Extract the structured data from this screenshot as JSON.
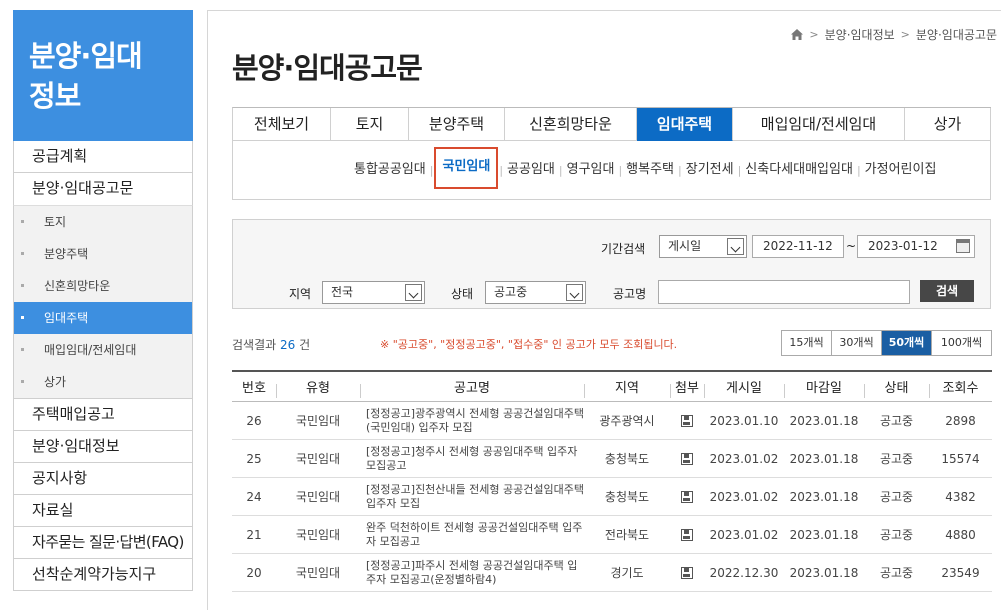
{
  "sidebar": {
    "title": "분양·임대\n정보",
    "items_top": [
      "공급계획",
      "분양·임대공고문"
    ],
    "sub_items": [
      {
        "label": "토지",
        "active": false
      },
      {
        "label": "분양주택",
        "active": false
      },
      {
        "label": "신혼희망타운",
        "active": false
      },
      {
        "label": "임대주택",
        "active": true
      },
      {
        "label": "매입임대/전세임대",
        "active": false
      },
      {
        "label": "상가",
        "active": false
      }
    ],
    "items_bottom": [
      "주택매입공고",
      "분양·임대정보",
      "공지사항",
      "자료실",
      "자주묻는 질문·답변(FAQ)",
      "선착순계약가능지구"
    ]
  },
  "breadcrumb": [
    "분양·임대정보",
    "분양·임대공고문"
  ],
  "page_title": "분양·임대공고문",
  "tabs": [
    {
      "label": "전체보기",
      "width": 98,
      "active": false
    },
    {
      "label": "토지",
      "width": 78,
      "active": false
    },
    {
      "label": "분양주택",
      "width": 96,
      "active": false
    },
    {
      "label": "신혼희망타운",
      "width": 132,
      "active": false
    },
    {
      "label": "임대주택",
      "width": 96,
      "active": true
    },
    {
      "label": "매입임대/전세임대",
      "width": 172,
      "active": false
    },
    {
      "label": "상가",
      "width": 86,
      "active": false
    }
  ],
  "subtabs": [
    {
      "label": "통합공공임대",
      "active": false
    },
    {
      "label": "국민임대",
      "active": true
    },
    {
      "label": "공공임대",
      "active": false
    },
    {
      "label": "영구임대",
      "active": false
    },
    {
      "label": "행복주택",
      "active": false
    },
    {
      "label": "장기전세",
      "active": false
    },
    {
      "label": "신축다세대매입임대",
      "active": false
    },
    {
      "label": "가정어린이집",
      "active": false
    }
  ],
  "search": {
    "period_label": "기간검색",
    "period_type": "게시일",
    "date_from": "2022-11-12",
    "date_sep": "~",
    "date_to": "2023-01-12",
    "region_label": "지역",
    "region_value": "전국",
    "status_label": "상태",
    "status_value": "공고중",
    "name_label": "공고명",
    "name_value": "",
    "button_label": "검색"
  },
  "result": {
    "prefix": "검색결과",
    "count": "26",
    "suffix": "건",
    "notice": "※ \"공고중\", \"정정공고중\", \"접수중\" 인 공고가 모두 조회됩니다."
  },
  "page_sizes": [
    {
      "label": "15개씩",
      "active": false
    },
    {
      "label": "30개씩",
      "active": false
    },
    {
      "label": "50개씩",
      "active": true
    },
    {
      "label": "100개씩",
      "active": false
    }
  ],
  "table": {
    "headers": [
      "번호",
      "유형",
      "공고명",
      "지역",
      "첨부",
      "게시일",
      "마감일",
      "상태",
      "조회수"
    ],
    "rows": [
      {
        "no": "26",
        "type": "국민임대",
        "title": "[정정공고]광주광역시 전세형 공공건설임대주택(국민임대) 입주자 모집",
        "region": "광주광역시",
        "posted": "2023.01.10",
        "deadline": "2023.01.18",
        "status": "공고중",
        "views": "2898"
      },
      {
        "no": "25",
        "type": "국민임대",
        "title": "[정정공고]청주시 전세형 공공임대주택 입주자 모집공고",
        "region": "충청북도",
        "posted": "2023.01.02",
        "deadline": "2023.01.18",
        "status": "공고중",
        "views": "15574"
      },
      {
        "no": "24",
        "type": "국민임대",
        "title": "[정정공고]진천산내들 전세형 공공건설임대주택 입주자 모집",
        "region": "충청북도",
        "posted": "2023.01.02",
        "deadline": "2023.01.18",
        "status": "공고중",
        "views": "4382"
      },
      {
        "no": "21",
        "type": "국민임대",
        "title": "완주 덕천하이트 전세형 공공건설임대주택 입주자 모집공고",
        "region": "전라북도",
        "posted": "2023.01.02",
        "deadline": "2023.01.18",
        "status": "공고중",
        "views": "4880"
      },
      {
        "no": "20",
        "type": "국민임대",
        "title": "[정정공고]파주시 전세형 공공건설임대주택 입주자 모집공고(운정별하람4)",
        "region": "경기도",
        "posted": "2022.12.30",
        "deadline": "2023.01.18",
        "status": "공고중",
        "views": "23549"
      }
    ]
  }
}
